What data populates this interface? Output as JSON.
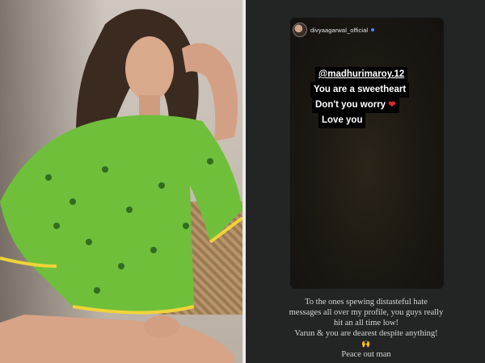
{
  "photo": {
    "alt_icon": "person-photo"
  },
  "story": {
    "username": "divyaagarwal_official",
    "verified_icon": "verified-icon",
    "lines": {
      "mention": "@madhurimaroy.12",
      "line2": "You are a sweetheart",
      "line3": "Don't you worry",
      "heart": "❤",
      "line4": "Love you"
    }
  },
  "caption": {
    "line1": "To the ones spewing distasteful hate",
    "line2": "messages all over my profile, you guys really",
    "line3": "hit an all time low!",
    "line4": "Varun & you are dearest despite anything!",
    "hands": "🙌",
    "line5": "Peace out man"
  },
  "colors": {
    "heart": "#e0282b",
    "dress": "#6fbf3a",
    "verified": "#3d8df5"
  }
}
